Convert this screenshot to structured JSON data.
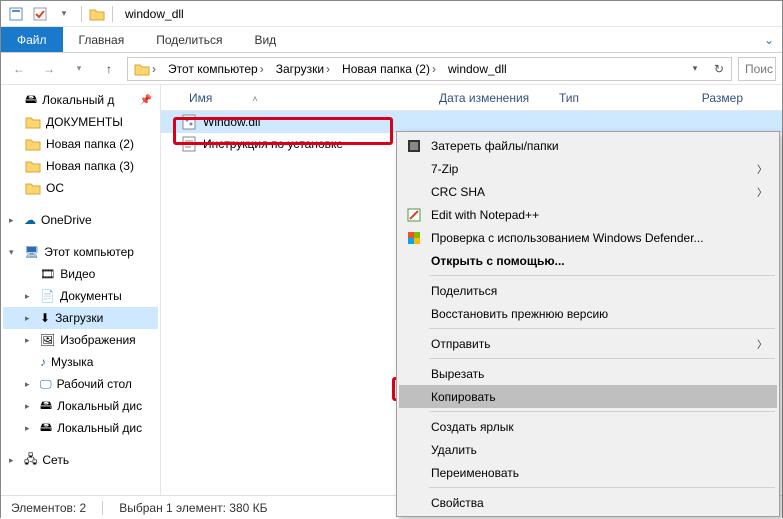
{
  "window": {
    "title": "window_dll"
  },
  "tabs": {
    "file": "Файл",
    "home": "Главная",
    "share": "Поделиться",
    "view": "Вид"
  },
  "breadcrumb": [
    "Этот компьютер",
    "Загрузки",
    "Новая папка (2)",
    "window_dll"
  ],
  "search": {
    "placeholder": "Поис"
  },
  "sidebar": {
    "quick": "Локальный д",
    "docs": "ДОКУМЕНТЫ",
    "nf2": "Новая папка (2)",
    "nf3": "Новая папка (3)",
    "oc": "ОС",
    "onedrive": "OneDrive",
    "thispc": "Этот компьютер",
    "videos": "Видео",
    "documents": "Документы",
    "downloads": "Загрузки",
    "pictures": "Изображения",
    "music": "Музыка",
    "desktop": "Рабочий стол",
    "ld1": "Локальный дис",
    "ld2": "Локальный дис",
    "network": "Сеть"
  },
  "columns": {
    "name": "Имя",
    "date": "Дата изменения",
    "type": "Тип",
    "size": "Размер"
  },
  "files": [
    {
      "name": "Window.dll"
    },
    {
      "name": "Инструкция по установке"
    }
  ],
  "context_menu": {
    "wipe": "Затереть файлы/папки",
    "sevenzip": "7-Zip",
    "crc": "CRC SHA",
    "notepad": "Edit with Notepad++",
    "defender": "Проверка с использованием Windows Defender...",
    "openwith": "Открыть с помощью...",
    "share": "Поделиться",
    "restore": "Восстановить прежнюю версию",
    "sendto": "Отправить",
    "cut": "Вырезать",
    "copy": "Копировать",
    "shortcut": "Создать ярлык",
    "delete": "Удалить",
    "rename": "Переименовать",
    "props": "Свойства"
  },
  "statusbar": {
    "count": "Элементов: 2",
    "selection": "Выбран 1 элемент: 380 КБ"
  }
}
